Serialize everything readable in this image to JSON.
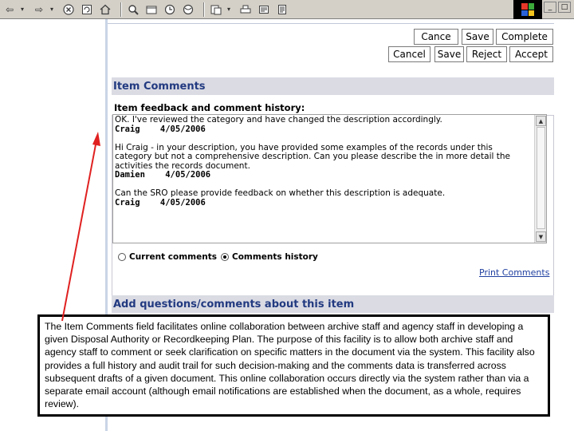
{
  "browser": {
    "toolbar_icons": [
      "back-icon",
      "forward-icon",
      "stop-icon",
      "refresh-icon",
      "home-icon",
      "search-icon",
      "favorites-icon",
      "history-icon",
      "media-icon",
      "mail-icon",
      "print-icon",
      "edit-icon",
      "discuss-icon"
    ]
  },
  "actions": {
    "row1": [
      "Cance",
      "Save",
      "Complete"
    ],
    "row2": [
      "Cancel",
      "Save",
      "Reject",
      "Accept"
    ]
  },
  "item_comments": {
    "title": "Item Comments",
    "history_label": "Item feedback and comment history:",
    "entries": [
      {
        "text": "OK. I've reviewed the category and have changed the description accordingly.",
        "author": "Craig",
        "date": "4/05/2006"
      },
      {
        "text": "Hi Craig - in your description, you have provided some examples of the records under this category but not a comprehensive description. Can you please describe the in more detail the activities the records document.",
        "author": "Damien",
        "date": "4/05/2006"
      },
      {
        "text": "Can the SRO please provide feedback on whether this description is adequate.",
        "author": "Craig",
        "date": "4/05/2006"
      }
    ],
    "radio_current": "Current comments",
    "radio_history": "Comments history",
    "print_link": "Print Comments"
  },
  "add_section": {
    "title": "Add questions/comments about this item"
  },
  "caption": {
    "text": "The Item Comments field facilitates online collaboration between archive staff and agency staff in developing a given Disposal Authority or Recordkeeping Plan. The purpose of this facility is to allow both archive staff and agency staff to comment or seek clarification on specific matters in the document via the system. This facility also provides a full history and audit trail for such decision-making and the comments data is transferred across subsequent drafts of a given document. This online collaboration occurs directly via the system rather than via a separate email account (although email notifications are established when the document, as a whole, requires review)."
  },
  "colors": {
    "section_header_bg": "#dadbe3",
    "section_header_text": "#223a80",
    "arrow": "#e02020",
    "link": "#2040a0"
  }
}
